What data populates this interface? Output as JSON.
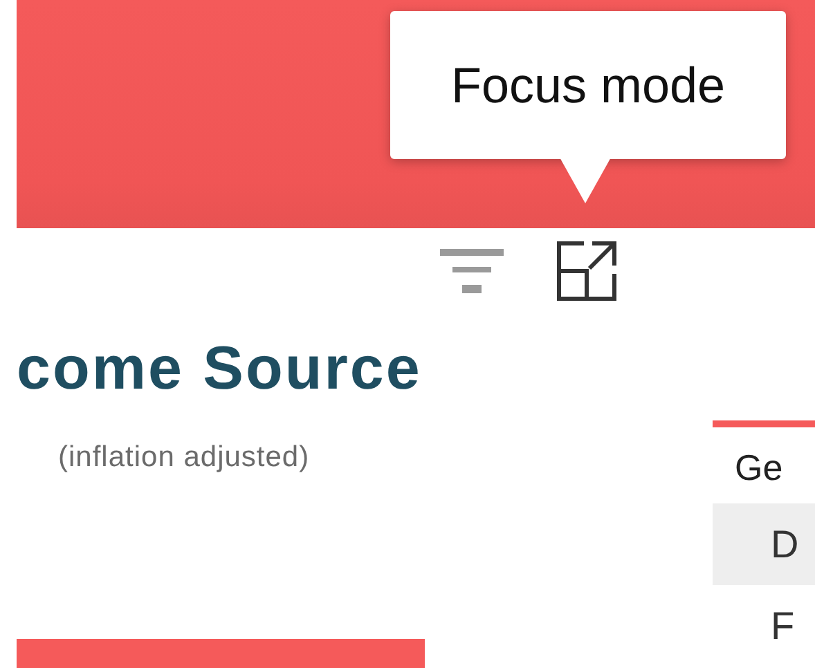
{
  "tooltip": {
    "text": "Focus mode"
  },
  "header_icons": [
    {
      "kind": "filter"
    },
    {
      "kind": "focus"
    }
  ],
  "visual": {
    "title": "come Source",
    "subtitle": "(inflation adjusted)"
  },
  "table": {
    "columns": [
      "Ge"
    ],
    "rows": [
      {
        "cells": [
          "D"
        ],
        "selected": true
      },
      {
        "cells": [
          "F"
        ],
        "selected": false
      }
    ]
  }
}
